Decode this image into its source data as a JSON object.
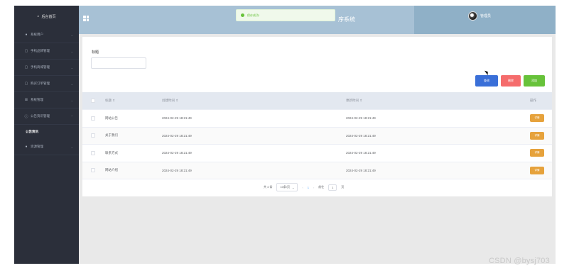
{
  "sidebar": {
    "header": "后台首页",
    "items": [
      {
        "label": "系统用户",
        "icon": "user-icon"
      },
      {
        "label": "手机品牌管理",
        "icon": "doc-icon"
      },
      {
        "label": "手机商城管理",
        "icon": "doc-icon"
      },
      {
        "label": "购买订单管理",
        "icon": "doc-icon"
      },
      {
        "label": "系统管理",
        "icon": "list-icon"
      },
      {
        "label": "公告资讯管理",
        "icon": "info-icon"
      }
    ],
    "active_sub": "公告资讯",
    "last_item": {
      "label": "资源管理",
      "icon": "dot-icon"
    }
  },
  "topbar": {
    "title": "序系统",
    "admin_name": "管理员"
  },
  "toast": {
    "message": "保存成功!"
  },
  "search": {
    "label": "标题",
    "value": ""
  },
  "buttons": {
    "search": "查询",
    "delete": "删除",
    "add": "添加"
  },
  "table": {
    "headers": {
      "title": "标题 ⇕",
      "created": "创建时间 ⇕",
      "updated": "更新时间 ⇕",
      "operation": "操作"
    },
    "rows": [
      {
        "title": "网站公告",
        "created": "2024-02-29 18:21:49",
        "updated": "2024-02-29 18:21:49",
        "action": "详情"
      },
      {
        "title": "关于我们",
        "created": "2024-02-29 18:21:49",
        "updated": "2024-02-29 18:21:49",
        "action": "详情"
      },
      {
        "title": "联系方式",
        "created": "2024-02-29 18:21:49",
        "updated": "2024-02-29 18:21:49",
        "action": "详情"
      },
      {
        "title": "网站介绍",
        "created": "2024-02-29 18:21:49",
        "updated": "2024-02-29 18:21:49",
        "action": "详情"
      }
    ]
  },
  "pagination": {
    "total": "共 4 条",
    "page_size": "10条/页",
    "current_page": "1",
    "goto_label": "前往",
    "goto_value": "1",
    "page_suffix": "页"
  },
  "watermark": "CSDN @bysj703"
}
